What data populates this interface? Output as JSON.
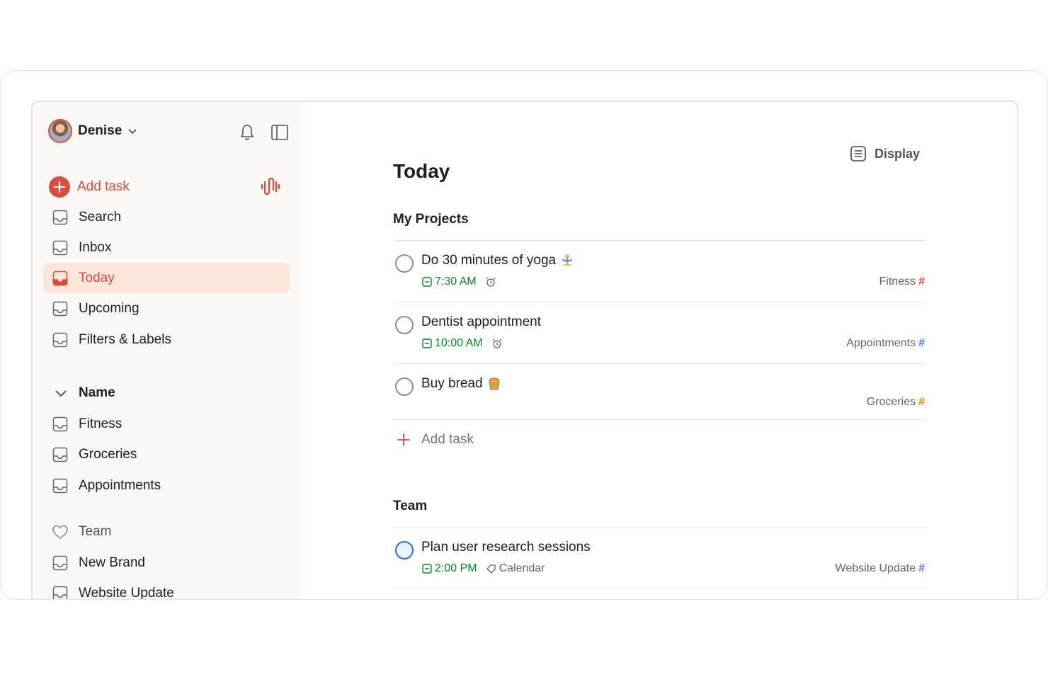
{
  "user": {
    "name": "Denise"
  },
  "sidebar": {
    "add_task": "Add task",
    "items": [
      {
        "label": "Search"
      },
      {
        "label": "Inbox"
      },
      {
        "label": "Today"
      },
      {
        "label": "Upcoming"
      },
      {
        "label": "Filters & Labels"
      }
    ],
    "my_section": {
      "title": "Name",
      "projects": [
        {
          "label": "Fitness"
        },
        {
          "label": "Groceries"
        },
        {
          "label": "Appointments"
        }
      ]
    },
    "team_section": {
      "title": "Team",
      "projects": [
        {
          "label": "New Brand"
        },
        {
          "label": "Website Update"
        }
      ]
    }
  },
  "main": {
    "display_label": "Display",
    "title": "Today",
    "groups": [
      {
        "title": "My Projects",
        "tasks": [
          {
            "title": "Do 30 minutes of yoga",
            "time": "7:30 AM",
            "project": "Fitness",
            "hash_color": "#dc4c3e"
          },
          {
            "title": "Dentist appointment",
            "time": "10:00 AM",
            "project": "Appointments",
            "hash_color": "#4073ff"
          },
          {
            "title": "Buy bread",
            "time": "",
            "project": "Groceries",
            "hash_color": "#eb8909"
          }
        ],
        "add_task": "Add task"
      },
      {
        "title": "Team",
        "tasks": [
          {
            "title": "Plan user research sessions",
            "time": "2:00 PM",
            "label": "Calendar",
            "project": "Website Update",
            "hash_color": "#884dff"
          }
        ]
      }
    ]
  },
  "colors": {
    "accent": "#dc4c3e",
    "date_green": "#058527",
    "active_bg": "#fbe6dc",
    "sidebar_bg": "#fbf8f5"
  }
}
